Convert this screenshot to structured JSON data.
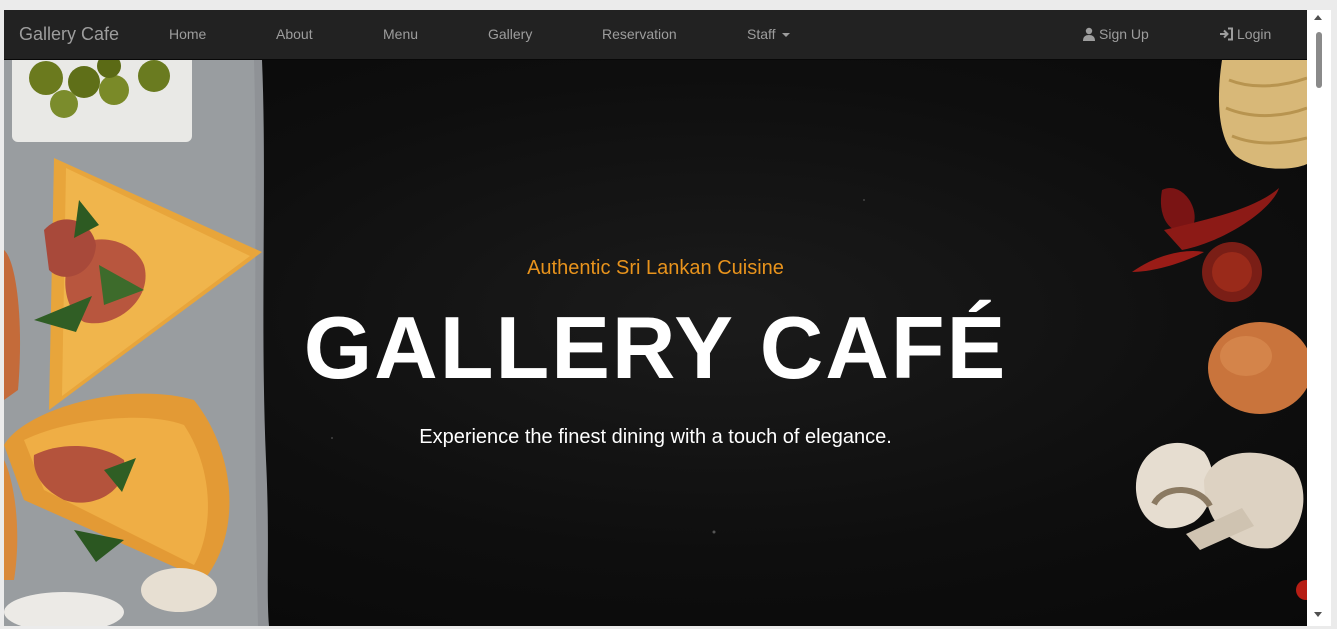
{
  "navbar": {
    "brand": "Gallery Cafe",
    "links": {
      "home": "Home",
      "about": "About",
      "menu": "Menu",
      "gallery": "Gallery",
      "reservation": "Reservation",
      "staff": "Staff"
    },
    "right": {
      "signup": "Sign Up",
      "login": "Login"
    },
    "icons": {
      "signup": "user-icon",
      "login": "login-icon",
      "staff": "caret-down-icon"
    }
  },
  "hero": {
    "tagline": "Authentic Sri Lankan Cuisine",
    "title": "GALLERY CAFÉ",
    "subtitle": "Experience the finest dining with a touch of elegance."
  },
  "colors": {
    "navbar_bg": "#222222",
    "nav_text": "#9d9d9d",
    "accent": "#e8931c",
    "hero_bg": "#0e0e0e",
    "hero_text": "#ffffff"
  }
}
